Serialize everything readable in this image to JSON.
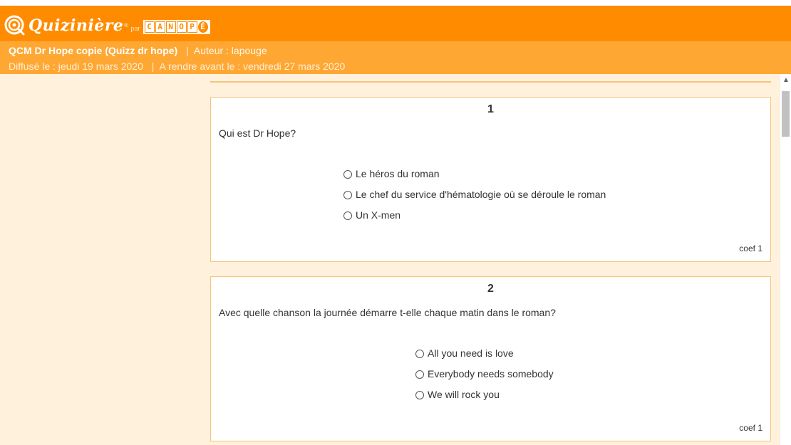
{
  "brand": {
    "name": "Quizinière",
    "reg": "®",
    "par": "par",
    "canope_letters": [
      "C",
      "A",
      "N",
      "O",
      "P",
      "É"
    ]
  },
  "quiz": {
    "title": "QCM Dr Hope copie (Quizz dr hope)",
    "author_sep": "|",
    "author": "Auteur : lapouge",
    "diffuse": "Diffusé le : jeudi 19 mars 2020",
    "deadline_sep": "|",
    "deadline": "A rendre avant le : vendredi 27 mars 2020"
  },
  "questions": [
    {
      "number": "1",
      "text": "Qui est Dr Hope?",
      "options": [
        "Le héros du roman",
        "Le chef du service d'hématologie où se déroule le roman",
        "Un X-men"
      ],
      "coef": "coef 1"
    },
    {
      "number": "2",
      "text": "Avec quelle chanson la journée démarre t-elle chaque matin dans le roman?",
      "options": [
        "All you need is love",
        "Everybody needs somebody",
        "We will rock you"
      ],
      "coef": "coef 1"
    }
  ],
  "colors": {
    "header": "#ff8c00",
    "info_bar": "#ffa733",
    "content_bg": "#fff1dc",
    "card_border": "#f4c47a"
  },
  "icons": {
    "logo": "quiziniere-q-logo-icon",
    "scroll_up": "chevron-up-icon"
  }
}
